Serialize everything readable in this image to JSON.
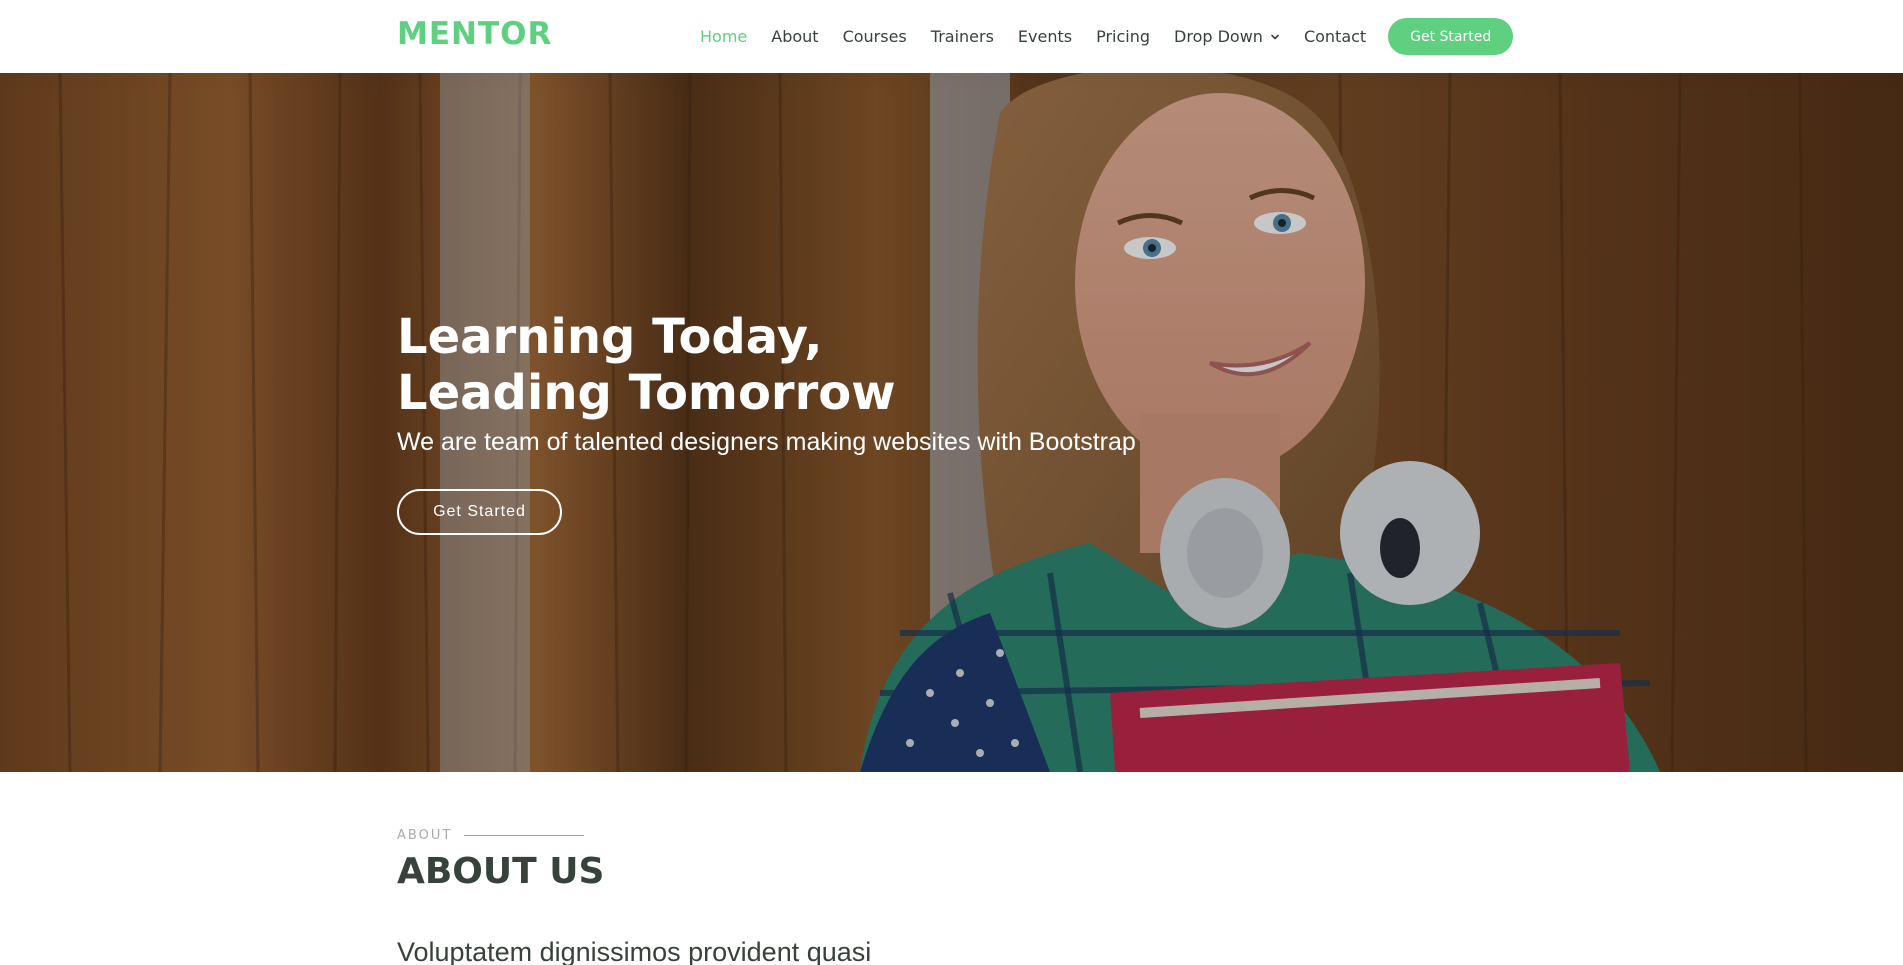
{
  "brand": {
    "logo": "MENTOR",
    "accent_color": "#5fcf80",
    "text_color": "#37423b"
  },
  "nav": {
    "items": [
      {
        "label": "Home",
        "active": true
      },
      {
        "label": "About",
        "active": false
      },
      {
        "label": "Courses",
        "active": false
      },
      {
        "label": "Trainers",
        "active": false
      },
      {
        "label": "Events",
        "active": false
      },
      {
        "label": "Pricing",
        "active": false
      },
      {
        "label": "Drop Down",
        "active": false,
        "dropdown": true
      },
      {
        "label": "Contact",
        "active": false
      }
    ],
    "cta_label": "Get Started"
  },
  "hero": {
    "title_line1": "Learning Today,",
    "title_line2": "Leading Tomorrow",
    "subtitle": "We are team of talented designers making websites with Bootstrap",
    "button_label": "Get Started"
  },
  "about": {
    "eyebrow": "ABOUT",
    "title": "ABOUT US",
    "lead": "Voluptatem dignissimos provident quasi"
  },
  "icons": {
    "dropdown": "chevron-down-icon"
  }
}
